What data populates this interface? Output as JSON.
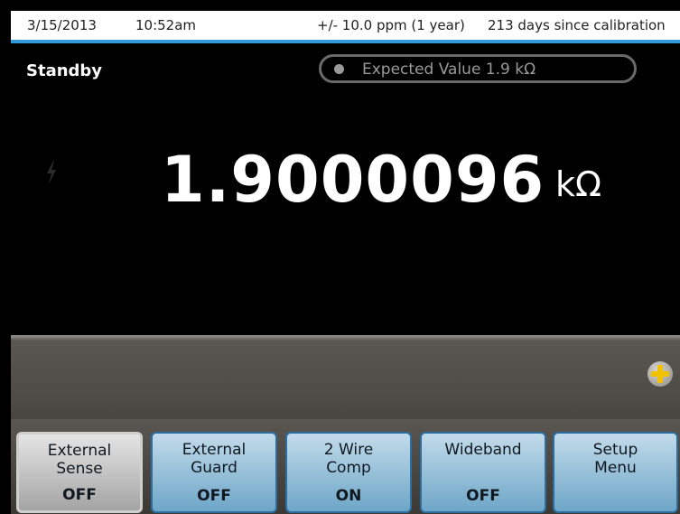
{
  "status_bar": {
    "date": "3/15/2013",
    "time": "10:52am",
    "spec": "+/- 10.0 ppm (1 year)",
    "calibration": "213 days since calibration"
  },
  "display": {
    "mode": "Standby",
    "expected_value": "Expected Value 1.9 kΩ",
    "reading": "1.9000096",
    "unit": "kΩ",
    "high_voltage_icon": "lightning-icon"
  },
  "aux_panel": {
    "more_icon": "plus-icon"
  },
  "softkeys": [
    {
      "line1": "External",
      "line2": "Sense",
      "value": "OFF",
      "style": "gray"
    },
    {
      "line1": "External",
      "line2": "Guard",
      "value": "OFF",
      "style": "blue"
    },
    {
      "line1": "2 Wire",
      "line2": "Comp",
      "value": "ON",
      "style": "blue"
    },
    {
      "line1": "Wideband",
      "line2": "",
      "value": "OFF",
      "style": "blue"
    },
    {
      "line1": "Setup",
      "line2": "Menu",
      "value": "",
      "style": "blue"
    }
  ],
  "colors": {
    "accent_line": "#3399dd",
    "softkey_blue": "#8fbcd8",
    "softkey_selected": "#c4c4c4",
    "plus_icon": "#f2c200"
  }
}
